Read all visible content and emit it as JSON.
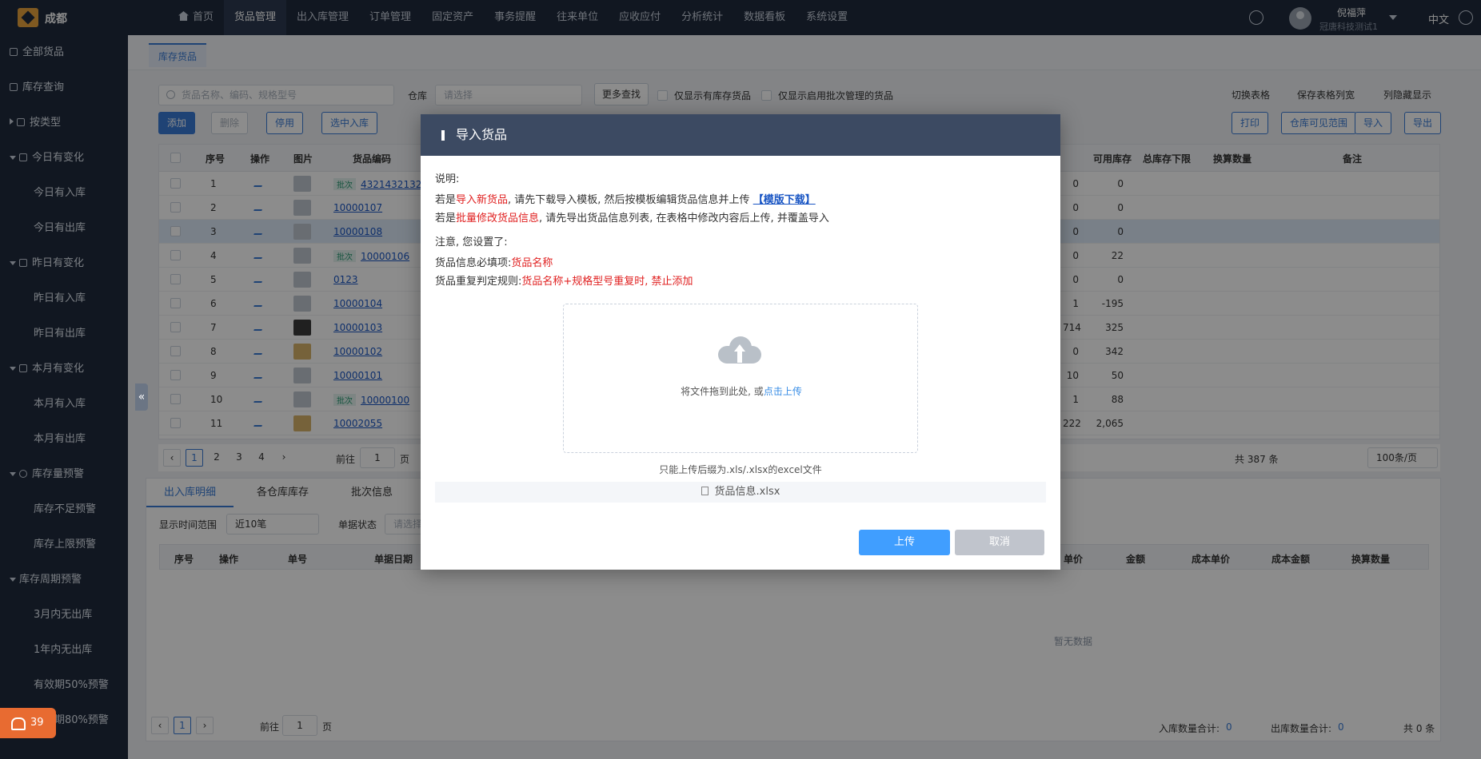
{
  "topbar": {
    "city": "成都",
    "nav": [
      "首页",
      "货品管理",
      "出入库管理",
      "订单管理",
      "固定资产",
      "事务提醒",
      "往来单位",
      "应收应付",
      "分析统计",
      "数据看板",
      "系统设置"
    ],
    "user_name": "倪福萍",
    "user_company": "冠唐科技测试1",
    "lang": "中文"
  },
  "sidebar": {
    "items": [
      "全部货品",
      "库存查询",
      "按类型",
      "今日有变化",
      "今日有入库",
      "今日有出库",
      "昨日有变化",
      "昨日有入库",
      "昨日有出库",
      "本月有变化",
      "本月有入库",
      "本月有出库",
      "库存量预警",
      "库存不足预警",
      "库存上限预警",
      "库存周期预警",
      "3月内无出库",
      "1年内无出库",
      "有效期50%预警",
      "有效期80%预警"
    ],
    "alarm_count": "39"
  },
  "page_tab": "库存货品",
  "toolbar": {
    "search_placeholder": "货品名称、编码、规格型号",
    "warehouse_label": "仓库",
    "warehouse_placeholder": "请选择",
    "more_search": "更多查找",
    "only_stock": "仅显示有库存货品",
    "only_batch": "仅显示启用批次管理的货品",
    "switch_table": "切换表格",
    "save_cols": "保存表格列宽",
    "hide_cols": "列隐藏显示",
    "add": "添加",
    "delete": "删除",
    "disable": "停用",
    "select_in": "选中入库",
    "print": "打印",
    "warehouse_scope": "仓库可见范围",
    "import": "导入",
    "export": "导出"
  },
  "grid": {
    "headers": [
      "序号",
      "操作",
      "图片",
      "货品编码",
      "可用库存",
      "总库存下限",
      "换算数量",
      "备注"
    ],
    "rows": [
      {
        "no": "1",
        "code": "4321432132",
        "batch": "批次",
        "qty": "0",
        "avail": "0"
      },
      {
        "no": "2",
        "code": "10000107",
        "batch": "",
        "qty": "0",
        "avail": "0"
      },
      {
        "no": "3",
        "code": "10000108",
        "batch": "",
        "qty": "0",
        "avail": "0"
      },
      {
        "no": "4",
        "code": "10000106",
        "batch": "批次",
        "qty": "0",
        "avail": "22"
      },
      {
        "no": "5",
        "code": "0123",
        "batch": "",
        "qty": "0",
        "avail": "0"
      },
      {
        "no": "6",
        "code": "10000104",
        "batch": "",
        "qty": "1",
        "avail": "-195"
      },
      {
        "no": "7",
        "code": "10000103",
        "batch": "",
        "qty": "714",
        "avail": "325"
      },
      {
        "no": "8",
        "code": "10000102",
        "batch": "",
        "qty": "0",
        "avail": "342"
      },
      {
        "no": "9",
        "code": "10000101",
        "batch": "",
        "qty": "10",
        "avail": "50"
      },
      {
        "no": "10",
        "code": "10000100",
        "batch": "批次",
        "qty": "1",
        "avail": "88"
      },
      {
        "no": "11",
        "code": "10002055",
        "batch": "",
        "qty": "222",
        "avail": "2,065"
      }
    ]
  },
  "pager": {
    "pages": [
      "1",
      "2",
      "3",
      "4"
    ],
    "goto": "前往",
    "goto_val": "1",
    "page_unit": "页",
    "total": "共 387 条",
    "per_page": "100条/页"
  },
  "lower": {
    "tabs": [
      "出入库明细",
      "各仓库库存",
      "批次信息"
    ],
    "range_label": "显示时间范围",
    "range_value": "近10笔",
    "status_label": "单据状态",
    "status_placeholder": "请选择",
    "headers": [
      "序号",
      "操作",
      "单号",
      "单据日期",
      "单价",
      "金额",
      "成本单价",
      "成本金额",
      "换算数量"
    ],
    "empty": "暂无数据",
    "goto": "前往",
    "goto_val": "1",
    "page_unit": "页",
    "in_total_label": "入库数量合计:",
    "in_total": "0",
    "out_total_label": "出库数量合计:",
    "out_total": "0",
    "count": "共 0 条",
    "page": "1"
  },
  "modal": {
    "title": "导入货品",
    "desc_label": "说明:",
    "line1_pre": "若是",
    "line1_red": "导入新货品",
    "line1_post": ", 请先下载导入模板, 然后按模板编辑货品信息并上传",
    "line1_link": "【模版下载】",
    "line2_pre": "若是",
    "line2_red": "批量修改货品信息",
    "line2_post": ", 请先导出货品信息列表, 在表格中修改内容后上传, 并覆盖导入",
    "note": "注意, 您设置了:",
    "required_label": "货品信息必填项:",
    "required_value": "货品名称",
    "dup_label": "货品重复判定规则:",
    "dup_value": "货品名称+规格型号重复时, 禁止添加",
    "drop_text": "将文件拖到此处, 或",
    "drop_click": "点击上传",
    "hint": "只能上传后缀为.xls/.xlsx的excel文件",
    "file_name": "货品信息.xlsx",
    "upload": "上传",
    "cancel": "取消"
  }
}
